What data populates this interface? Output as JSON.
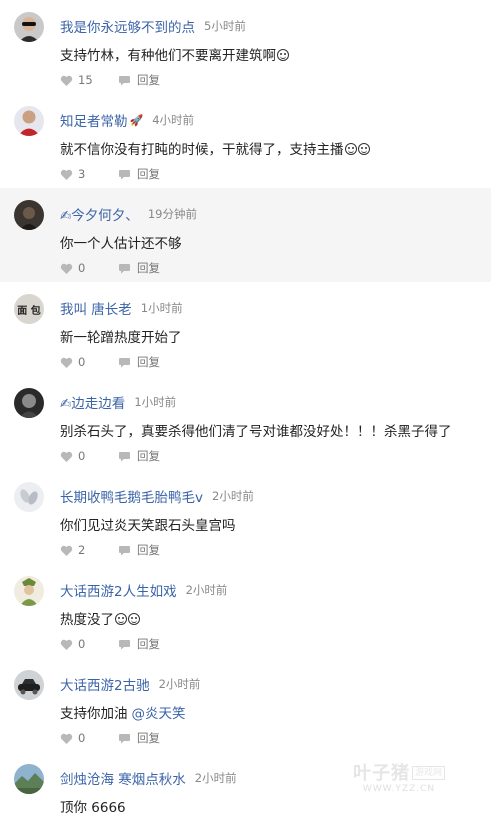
{
  "comments": [
    {
      "name": "我是你永远够不到的点",
      "time": "5小时前",
      "content": "支持竹林，有种他们不要离开建筑啊",
      "emoji_count": 1,
      "likes": "15",
      "reply": "回复",
      "avatar": "person-sunglasses"
    },
    {
      "name": "知足者常勒",
      "time": "4小时前",
      "content": "就不信你没有打盹的时候，干就得了，支持主播",
      "emoji_count": 2,
      "likes": "3",
      "reply": "回复",
      "avatar": "person-red"
    },
    {
      "name": "✍今夕何夕、",
      "time": "19分钟前",
      "content": "你一个人估计还不够",
      "emoji_count": 0,
      "likes": "0",
      "reply": "回复",
      "avatar": "dark-figure"
    },
    {
      "name": "我叫 唐长老",
      "time": "1小时前",
      "content": "新一轮蹭热度开始了",
      "emoji_count": 0,
      "likes": "0",
      "reply": "回复",
      "avatar": "text-avatar",
      "avatar_text": "面 包"
    },
    {
      "name": "✍边走边看",
      "time": "1小时前",
      "content": "别杀石头了，真要杀得他们清了号对谁都没好处！！！杀黑子得了",
      "emoji_count": 0,
      "likes": "0",
      "reply": "回复",
      "avatar": "dark-portrait"
    },
    {
      "name": "长期收鸭毛鹅毛胎鸭毛v",
      "time": "2小时前",
      "content": "你们见过炎天笑跟石头皇宫吗",
      "emoji_count": 0,
      "likes": "2",
      "reply": "回复",
      "avatar": "feathers"
    },
    {
      "name": "大话西游2人生如戏",
      "time": "2小时前",
      "content": "热度没了",
      "emoji_count": 2,
      "likes": "0",
      "reply": "回复",
      "avatar": "game-character"
    },
    {
      "name": "大话西游2古驰",
      "time": "2小时前",
      "content": "支持你加油",
      "mention": "@炎天笑",
      "emoji_count": 0,
      "likes": "0",
      "reply": "回复",
      "avatar": "car"
    },
    {
      "name": "剑烛沧海 寒烟点秋水",
      "time": "2小时前",
      "content": "顶你 6666",
      "emoji_count": 0,
      "likes": "",
      "reply": "",
      "avatar": "landscape"
    }
  ],
  "watermark": {
    "main": "叶子猪",
    "tag": "游戏网",
    "url": "WWW.YZZ.CN"
  },
  "colors": {
    "username": "#3b64a8",
    "time": "#888888",
    "text": "#222222",
    "highlight_bg": "#f5f5f5"
  }
}
